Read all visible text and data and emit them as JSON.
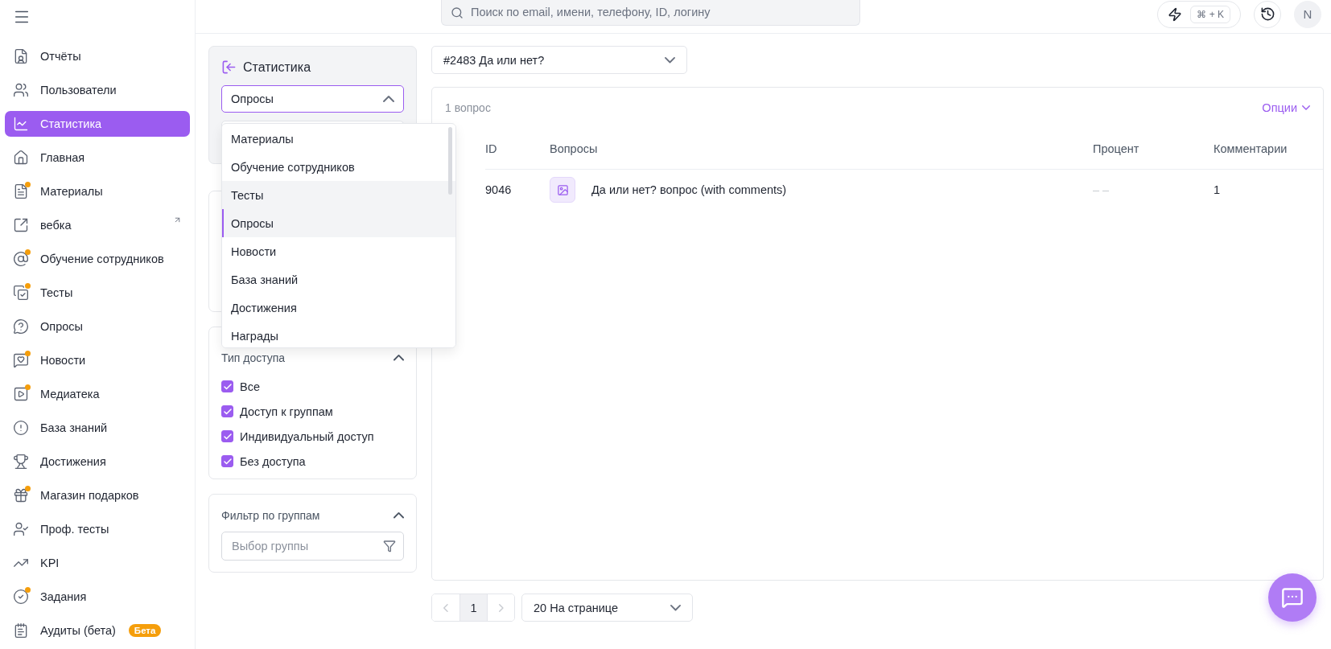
{
  "topbar": {
    "search_placeholder": "Поиск по email, имени, телефону, ID, логину",
    "shortcut": "⌘ + K",
    "avatar": "N"
  },
  "sidebar": {
    "items": [
      {
        "label": "Отчёты",
        "selected": false,
        "dot": false,
        "external": false
      },
      {
        "label": "Пользователи",
        "selected": false,
        "dot": false,
        "external": false
      },
      {
        "label": "Статистика",
        "selected": true,
        "dot": false,
        "external": false
      },
      {
        "label": "Главная",
        "selected": false,
        "dot": false,
        "external": false
      },
      {
        "label": "Материалы",
        "selected": false,
        "dot": true,
        "external": false
      },
      {
        "label": "вебка",
        "selected": false,
        "dot": false,
        "external": true
      },
      {
        "label": "Обучение сотрудников",
        "selected": false,
        "dot": true,
        "external": false
      },
      {
        "label": "Тесты",
        "selected": false,
        "dot": true,
        "external": false
      },
      {
        "label": "Опросы",
        "selected": false,
        "dot": false,
        "external": false
      },
      {
        "label": "Новости",
        "selected": false,
        "dot": true,
        "external": false
      },
      {
        "label": "Медиатека",
        "selected": false,
        "dot": true,
        "external": false
      },
      {
        "label": "База знаний",
        "selected": false,
        "dot": false,
        "external": false
      },
      {
        "label": "Достижения",
        "selected": false,
        "dot": false,
        "external": false
      },
      {
        "label": "Магазин подарков",
        "selected": false,
        "dot": true,
        "external": false
      },
      {
        "label": "Проф. тесты",
        "selected": false,
        "dot": false,
        "external": false
      },
      {
        "label": "KPI",
        "selected": false,
        "dot": false,
        "external": false
      },
      {
        "label": "Задания",
        "selected": false,
        "dot": true,
        "external": false
      },
      {
        "label": "Аудиты (бета)",
        "selected": false,
        "dot": false,
        "external": false,
        "badge": "Бета"
      }
    ]
  },
  "stats_panel": {
    "title": "Статистика",
    "section_select": {
      "value": "Опросы",
      "expanded": true
    },
    "options": [
      {
        "label": "Материалы",
        "selected": false,
        "highlighted": false
      },
      {
        "label": "Обучение сотрудников",
        "selected": false,
        "highlighted": false
      },
      {
        "label": "Тесты",
        "selected": false,
        "highlighted": true
      },
      {
        "label": "Опросы",
        "selected": true,
        "highlighted": false
      },
      {
        "label": "Новости",
        "selected": false,
        "highlighted": false
      },
      {
        "label": "База знаний",
        "selected": false,
        "highlighted": false
      },
      {
        "label": "Достижения",
        "selected": false,
        "highlighted": false
      },
      {
        "label": "Награды",
        "selected": false,
        "highlighted": false
      }
    ]
  },
  "access_filter": {
    "title": "Тип доступа",
    "expanded": true,
    "items": [
      {
        "label": "Все",
        "checked": true
      },
      {
        "label": "Доступ к группам",
        "checked": true
      },
      {
        "label": "Индивидуальный доступ",
        "checked": true
      },
      {
        "label": "Без доступа",
        "checked": true
      }
    ]
  },
  "group_filter": {
    "title": "Фильтр по группам",
    "expanded": true,
    "placeholder": "Выбор группы"
  },
  "quiz_select": {
    "value": "#2483 Да или нет?"
  },
  "table": {
    "count": "1 вопрос",
    "options_label": "Опции",
    "columns": [
      "ID",
      "Вопросы",
      "Процент",
      "Комментарии"
    ],
    "rows": [
      {
        "id": "9046",
        "question": "Да или нет? вопрос (with comments)",
        "percent": "– –",
        "comments": "1"
      }
    ]
  },
  "pagination": {
    "pages": [
      {
        "label": "1",
        "selected": true
      }
    ],
    "page_size": "20 На странице"
  }
}
